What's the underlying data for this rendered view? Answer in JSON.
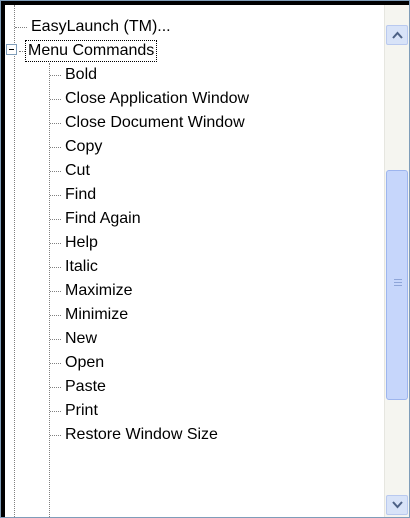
{
  "tree": {
    "root_items": [
      {
        "label": "EasyLaunch (TM)..."
      },
      {
        "label": "Menu Commands",
        "expanded": true,
        "selected": true
      }
    ],
    "children": [
      "Bold",
      "Close Application Window",
      "Close Document Window",
      "Copy",
      "Cut",
      "Find",
      "Find Again",
      "Help",
      "Italic",
      "Maximize",
      "Minimize",
      "New",
      "Open",
      "Paste",
      "Print",
      "Restore Window Size"
    ]
  },
  "scrollbar": {
    "up_icon": "arrow-up-icon",
    "down_icon": "arrow-down-icon"
  }
}
